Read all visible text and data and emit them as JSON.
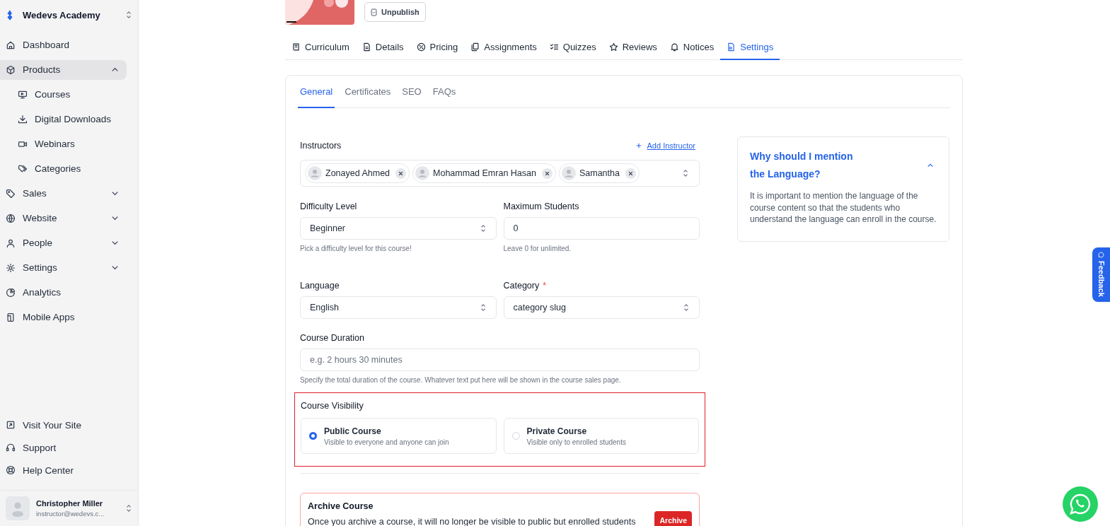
{
  "sidebar": {
    "workspace": "Wedevs Academy",
    "nav": [
      {
        "label": "Dashboard",
        "selected": false
      },
      {
        "label": "Products",
        "selected": true,
        "expanded": true,
        "children": [
          {
            "label": "Courses",
            "selected": false
          },
          {
            "label": "Digital Downloads",
            "selected": false
          },
          {
            "label": "Webinars",
            "selected": false
          },
          {
            "label": "Categories",
            "selected": false
          }
        ]
      },
      {
        "label": "Sales",
        "selected": false,
        "expanded": false
      },
      {
        "label": "Website",
        "selected": false,
        "expanded": false
      },
      {
        "label": "People",
        "selected": false,
        "expanded": false
      },
      {
        "label": "Settings",
        "selected": false,
        "expanded": false
      },
      {
        "label": "Analytics",
        "selected": false
      },
      {
        "label": "Mobile Apps",
        "selected": false
      }
    ],
    "footer_links": [
      "Visit Your Site",
      "Support",
      "Help Center"
    ],
    "user": {
      "name": "Christopher Miller",
      "email": "instructor@wedevs.c..."
    }
  },
  "header": {
    "unpublish_button": "Unpublish"
  },
  "tabs": [
    {
      "label": "Curriculum",
      "selected": false
    },
    {
      "label": "Details",
      "selected": false
    },
    {
      "label": "Pricing",
      "selected": false
    },
    {
      "label": "Assignments",
      "selected": false
    },
    {
      "label": "Quizzes",
      "selected": false
    },
    {
      "label": "Reviews",
      "selected": false
    },
    {
      "label": "Notices",
      "selected": false
    },
    {
      "label": "Settings",
      "selected": true
    }
  ],
  "settings": {
    "subtabs": [
      {
        "label": "General",
        "selected": true
      },
      {
        "label": "Certificates",
        "selected": false
      },
      {
        "label": "SEO",
        "selected": false
      },
      {
        "label": "FAQs",
        "selected": false
      }
    ],
    "instructors": {
      "label": "Instructors",
      "add_link": "Add Instructor",
      "chips": [
        "Zonayed Ahmed",
        "Mohammad Emran Hasan",
        "Samantha"
      ]
    },
    "difficulty": {
      "label": "Difficulty Level",
      "value": "Beginner",
      "hint": "Pick a difficulty level for this course!"
    },
    "max_students": {
      "label": "Maximum Students",
      "value": "0",
      "hint": "Leave 0 for unlimited."
    },
    "language": {
      "label": "Language",
      "value": "English"
    },
    "category": {
      "label": "Category",
      "required_mark": "*",
      "value": "category slug"
    },
    "duration": {
      "label": "Course Duration",
      "placeholder": "e.g. 2 hours 30 minutes",
      "hint": "Specify the total duration of the course. Whatever text put here will be shown in the course sales page."
    },
    "visibility": {
      "label": "Course Visibility",
      "highlighted": true,
      "options": [
        {
          "title": "Public Course",
          "description": "Visible to everyone and anyone can join",
          "selected": true
        },
        {
          "title": "Private Course",
          "description": "Visible only to enrolled students",
          "selected": false
        }
      ]
    },
    "archive": {
      "title": "Archive Course",
      "text": "Once you archive a course, it will no longer be visible to public but enrolled students",
      "button": "Archive"
    }
  },
  "help_card": {
    "title": "Why should I mention the Language?",
    "expanded": true,
    "body": "It is important to mention the language of the course content so that the students who understand the language can enroll in the course."
  },
  "feedback_tab": "Feedback"
}
